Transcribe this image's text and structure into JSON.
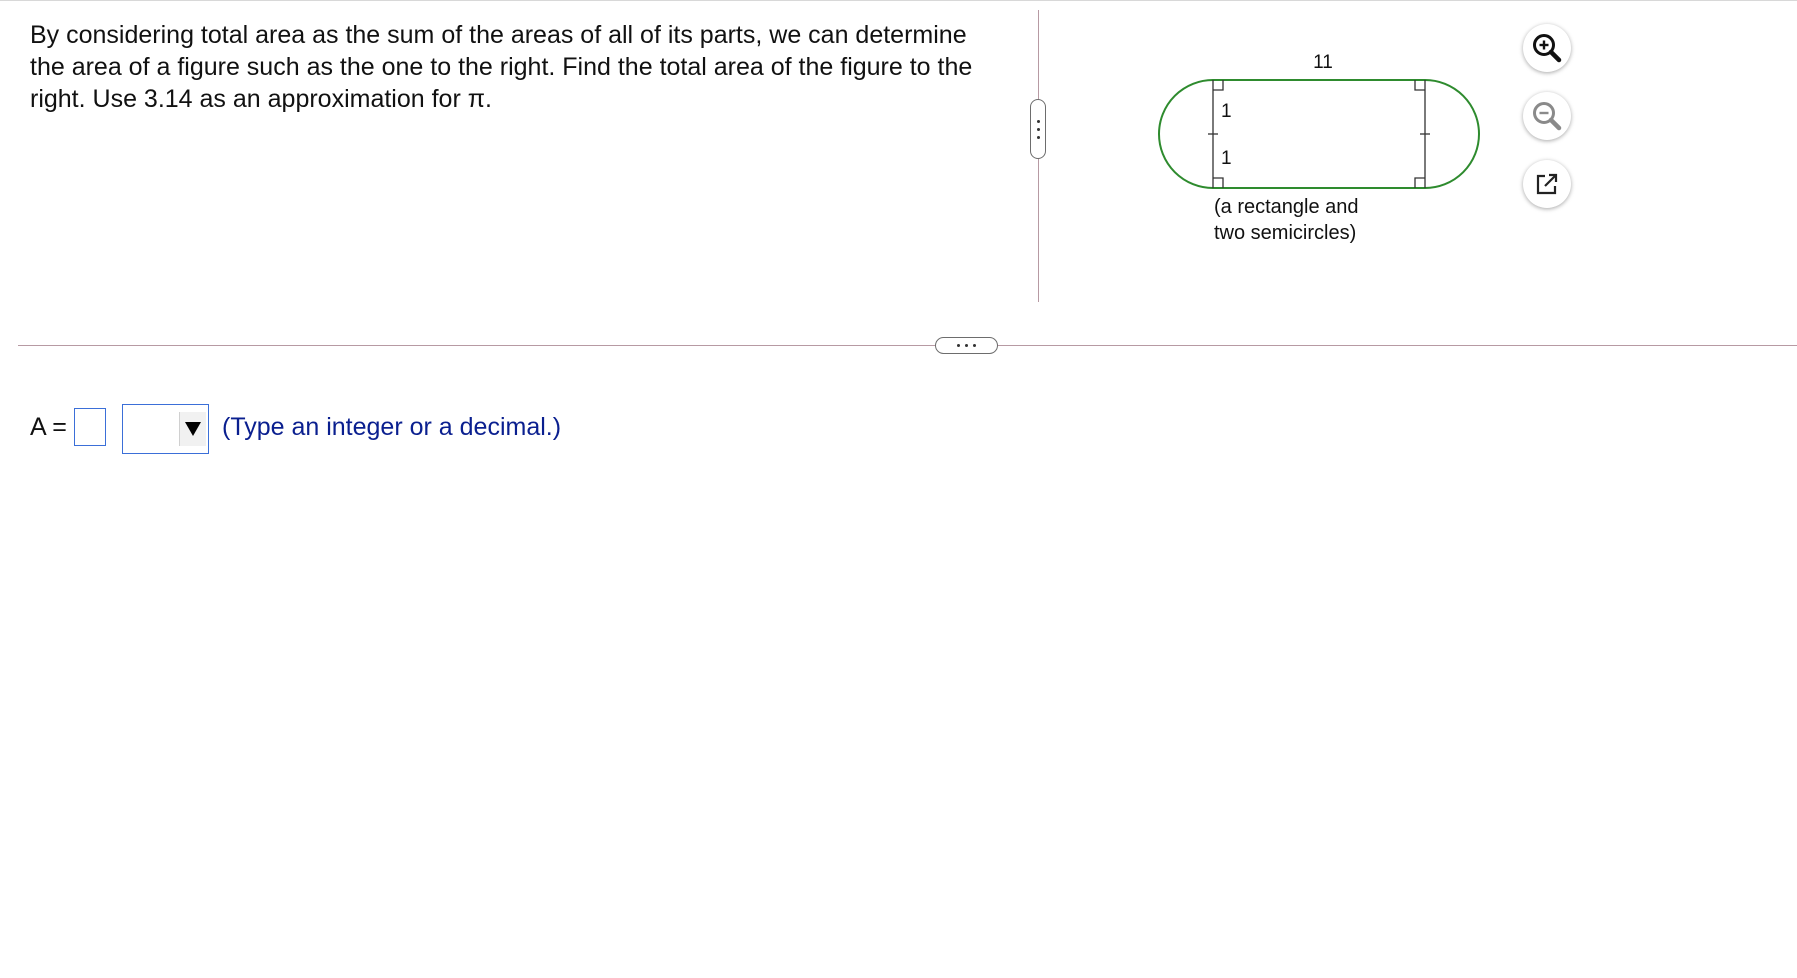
{
  "question": {
    "text": "By considering total area as the sum of the areas of all of its parts, we can determine the area of a figure such as the one to the right. Find the total area of the figure to the right. Use 3.14 as an approximation for π."
  },
  "figure": {
    "length_label": "11",
    "radius_label_top": "1",
    "radius_label_bottom": "1",
    "caption_line1": "(a rectangle and",
    "caption_line2": "two semicircles)",
    "stroke_color": "#2e8b2e"
  },
  "tools": {
    "zoom_in": "zoom-in-icon",
    "zoom_out": "zoom-out-icon",
    "popout": "popout-icon"
  },
  "answer": {
    "label": "A =",
    "value": "",
    "unit_selected": "",
    "hint": "(Type an integer or a decimal.)"
  },
  "colors": {
    "divider": "#b79aa3",
    "input_border": "#3b6fd8",
    "hint_text": "#0a1f8f"
  }
}
